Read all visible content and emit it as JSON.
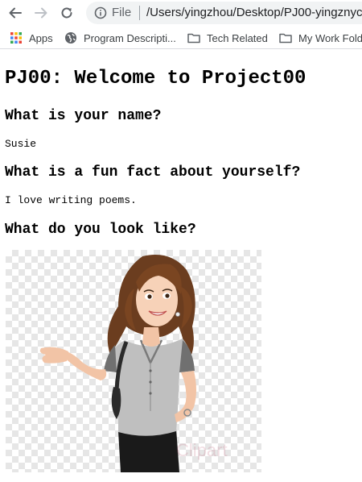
{
  "browser": {
    "url_scheme": "File",
    "url": "/Users/yingzhou/Desktop/PJ00-yingznyc",
    "bookmarks": [
      {
        "label": "Apps",
        "icon": "apps-grid-icon"
      },
      {
        "label": "Program Descripti...",
        "icon": "globe-icon"
      },
      {
        "label": "Tech Related",
        "icon": "folder-icon"
      },
      {
        "label": "My Work Fold",
        "icon": "folder-icon"
      }
    ]
  },
  "page": {
    "title": "PJ00: Welcome to Project00",
    "q1": "What is your name?",
    "a1": "Susie",
    "q2": "What is a fun fact about yourself?",
    "a2": "I love writing poems.",
    "q3": "What do you look like?",
    "image_watermark": "Clipart"
  }
}
